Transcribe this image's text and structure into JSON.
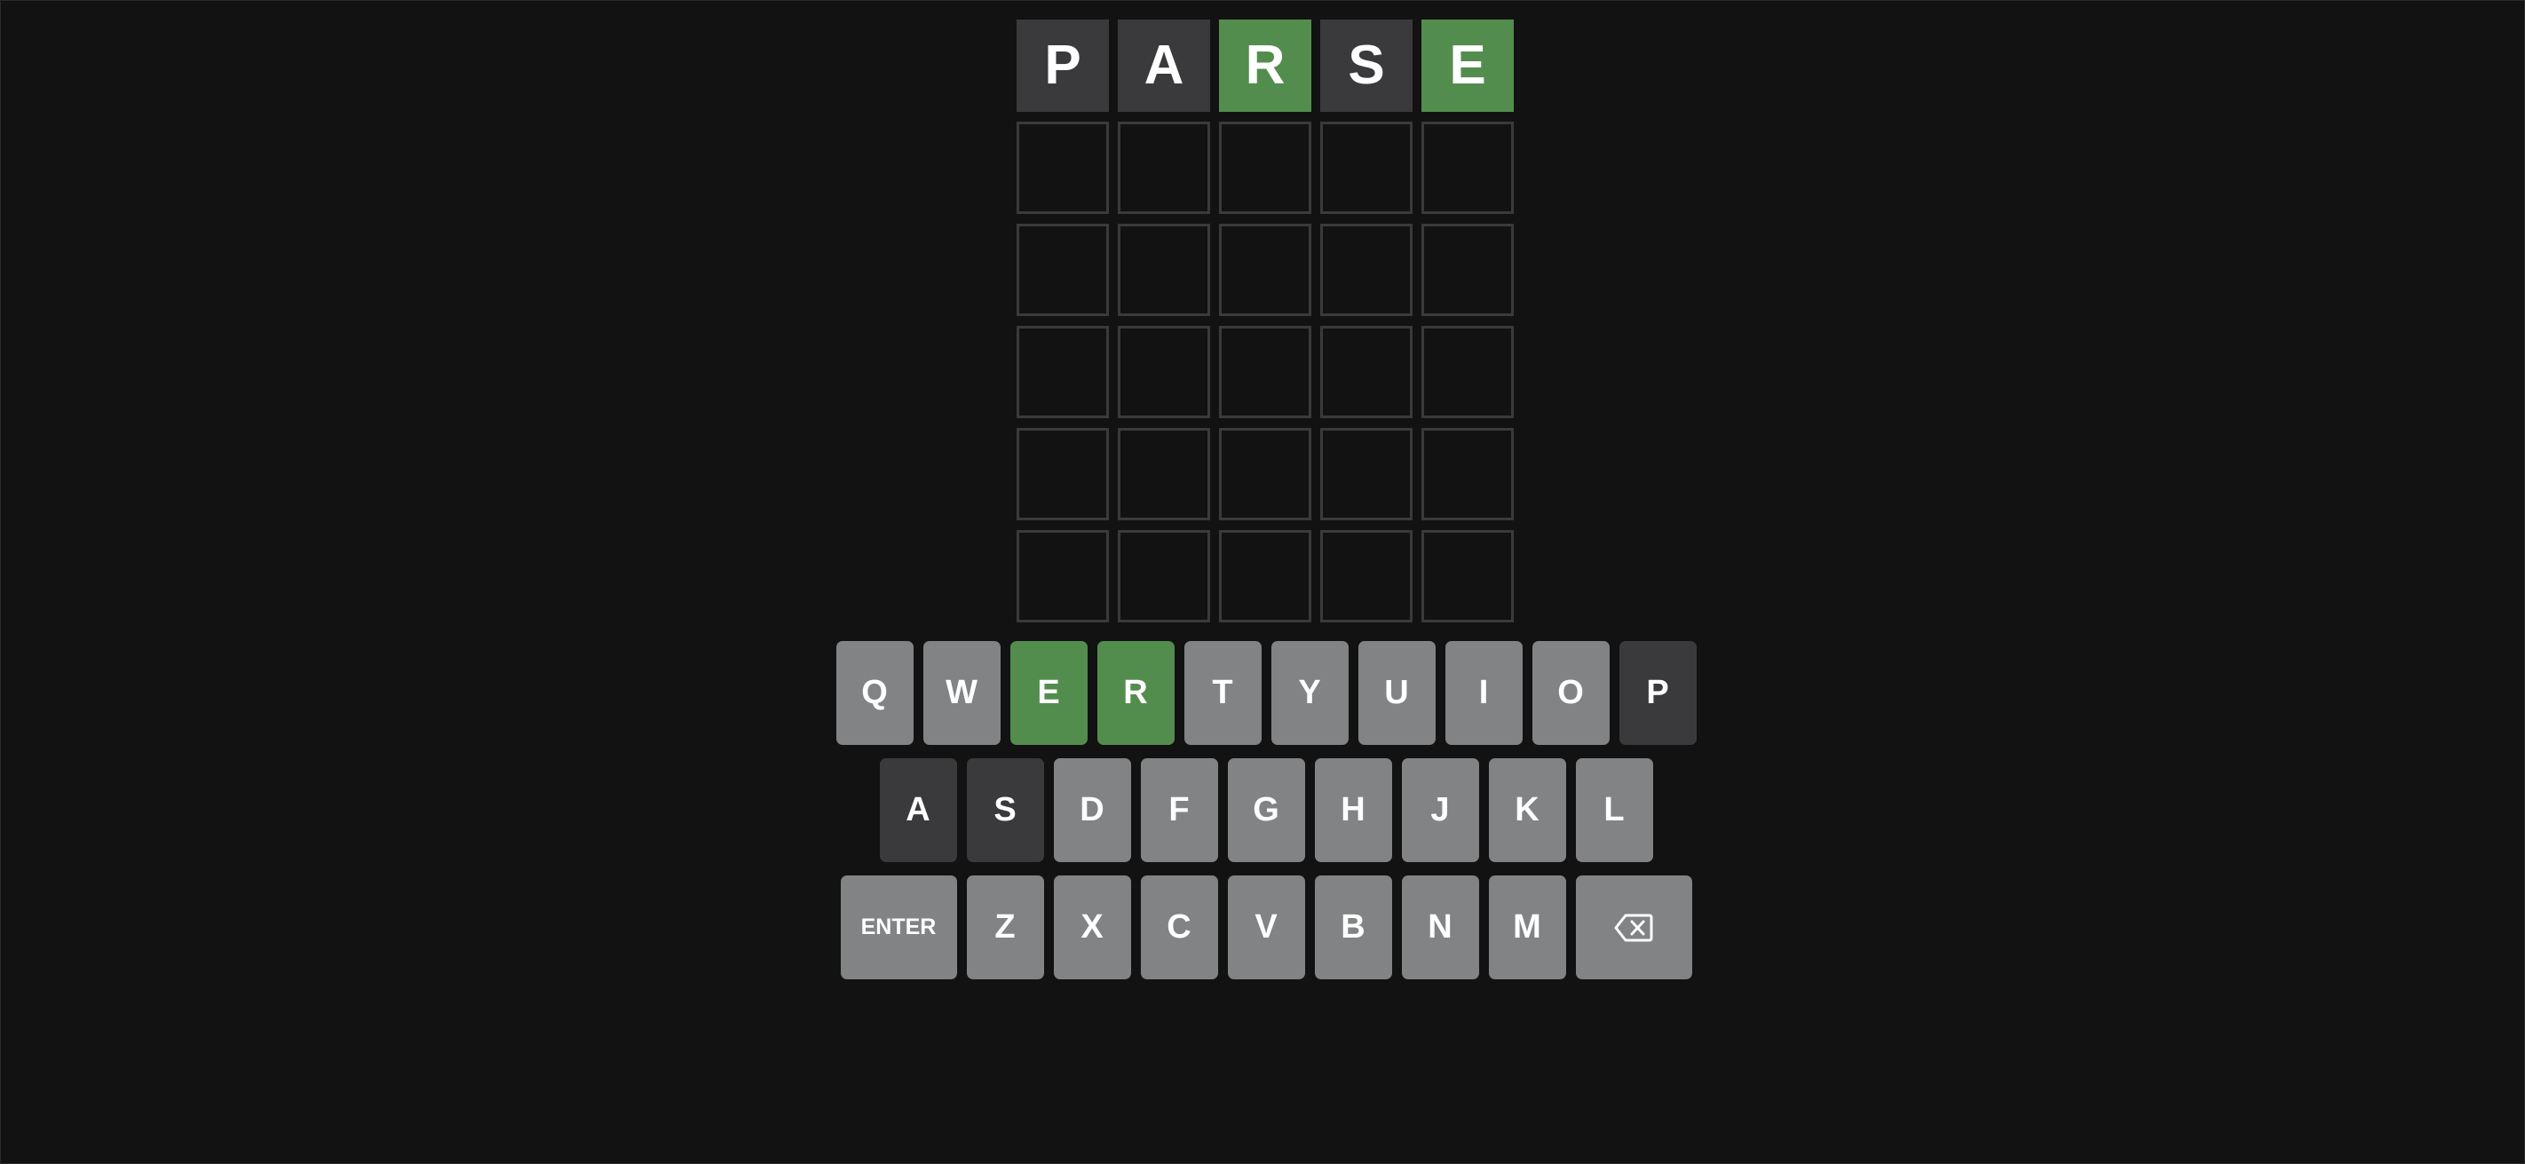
{
  "colors": {
    "background": "#121213",
    "correct": "#538d4e",
    "present": "#b59f3b",
    "absent": "#3a3a3c",
    "key_default": "#818384",
    "empty_border": "#3a3a3c",
    "text": "#ffffff"
  },
  "board": {
    "rows": [
      [
        {
          "letter": "P",
          "state": "absent"
        },
        {
          "letter": "A",
          "state": "absent"
        },
        {
          "letter": "R",
          "state": "correct"
        },
        {
          "letter": "S",
          "state": "absent"
        },
        {
          "letter": "E",
          "state": "correct"
        }
      ],
      [
        {
          "letter": "",
          "state": "empty"
        },
        {
          "letter": "",
          "state": "empty"
        },
        {
          "letter": "",
          "state": "empty"
        },
        {
          "letter": "",
          "state": "empty"
        },
        {
          "letter": "",
          "state": "empty"
        }
      ],
      [
        {
          "letter": "",
          "state": "empty"
        },
        {
          "letter": "",
          "state": "empty"
        },
        {
          "letter": "",
          "state": "empty"
        },
        {
          "letter": "",
          "state": "empty"
        },
        {
          "letter": "",
          "state": "empty"
        }
      ],
      [
        {
          "letter": "",
          "state": "empty"
        },
        {
          "letter": "",
          "state": "empty"
        },
        {
          "letter": "",
          "state": "empty"
        },
        {
          "letter": "",
          "state": "empty"
        },
        {
          "letter": "",
          "state": "empty"
        }
      ],
      [
        {
          "letter": "",
          "state": "empty"
        },
        {
          "letter": "",
          "state": "empty"
        },
        {
          "letter": "",
          "state": "empty"
        },
        {
          "letter": "",
          "state": "empty"
        },
        {
          "letter": "",
          "state": "empty"
        }
      ],
      [
        {
          "letter": "",
          "state": "empty"
        },
        {
          "letter": "",
          "state": "empty"
        },
        {
          "letter": "",
          "state": "empty"
        },
        {
          "letter": "",
          "state": "empty"
        },
        {
          "letter": "",
          "state": "empty"
        }
      ]
    ]
  },
  "keyboard": {
    "rows": [
      [
        {
          "label": "Q",
          "state": "unused"
        },
        {
          "label": "W",
          "state": "unused"
        },
        {
          "label": "E",
          "state": "correct"
        },
        {
          "label": "R",
          "state": "correct"
        },
        {
          "label": "T",
          "state": "unused"
        },
        {
          "label": "Y",
          "state": "unused"
        },
        {
          "label": "U",
          "state": "unused"
        },
        {
          "label": "I",
          "state": "unused"
        },
        {
          "label": "O",
          "state": "unused"
        },
        {
          "label": "P",
          "state": "absent"
        }
      ],
      [
        {
          "label": "A",
          "state": "absent"
        },
        {
          "label": "S",
          "state": "absent"
        },
        {
          "label": "D",
          "state": "unused"
        },
        {
          "label": "F",
          "state": "unused"
        },
        {
          "label": "G",
          "state": "unused"
        },
        {
          "label": "H",
          "state": "unused"
        },
        {
          "label": "J",
          "state": "unused"
        },
        {
          "label": "K",
          "state": "unused"
        },
        {
          "label": "L",
          "state": "unused"
        }
      ],
      [
        {
          "label": "ENTER",
          "state": "unused",
          "wide": true,
          "name": "enter-key"
        },
        {
          "label": "Z",
          "state": "unused"
        },
        {
          "label": "X",
          "state": "unused"
        },
        {
          "label": "C",
          "state": "unused"
        },
        {
          "label": "V",
          "state": "unused"
        },
        {
          "label": "B",
          "state": "unused"
        },
        {
          "label": "N",
          "state": "unused"
        },
        {
          "label": "M",
          "state": "unused"
        },
        {
          "label": "",
          "icon": "backspace-icon",
          "state": "unused",
          "wide": true,
          "name": "backspace-key"
        }
      ]
    ]
  }
}
